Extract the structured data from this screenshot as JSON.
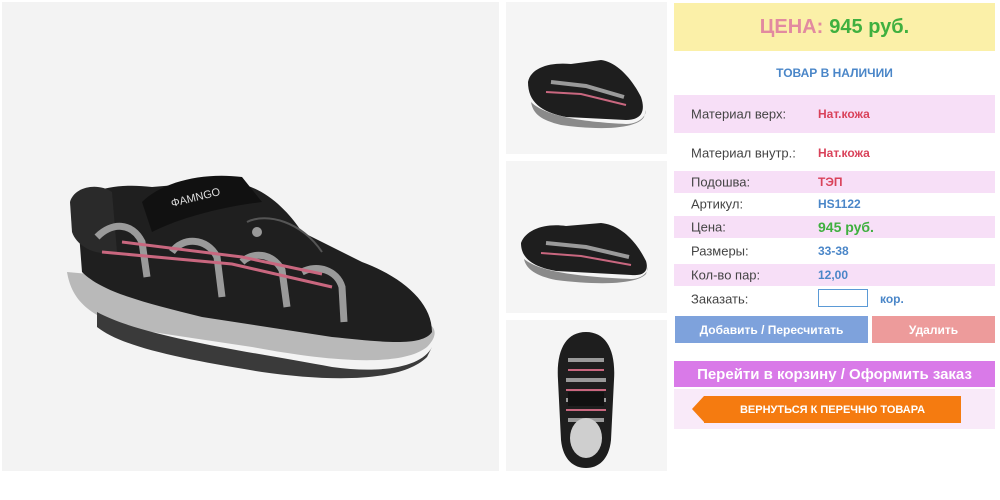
{
  "price_box": {
    "label": "ЦЕНА:",
    "value": "945 руб."
  },
  "stock": "ТОВАР В НАЛИЧИИ",
  "specs": [
    {
      "label": "Материал верх:",
      "value": "Нат.кожа"
    },
    {
      "label": "Материал внутр.:",
      "value": "Нат.кожа"
    },
    {
      "label": "Подошва:",
      "value": "ТЭП"
    },
    {
      "label": "Артикул:",
      "value": "HS1122"
    },
    {
      "label": "Цена:",
      "value": "945 руб."
    },
    {
      "label": "Размеры:",
      "value": "33-38"
    },
    {
      "label": "Кол-во пар:",
      "value": "12,00"
    }
  ],
  "order": {
    "label": "Заказать:",
    "input_value": "",
    "unit": "кор."
  },
  "buttons": {
    "add": "Добавить / Пересчитать",
    "delete": "Удалить",
    "cart": "Перейти в корзину / Оформить заказ",
    "back": "ВЕРНУТЬСЯ К ПЕРЕЧНЮ ТОВАРА"
  },
  "colors": {
    "price_bg": "#fbf0a8",
    "accent_green": "#3fb03f",
    "accent_blue": "#4a86c8",
    "accent_red": "#d9425a",
    "row_pink": "#f7dff7",
    "cart_btn": "#d97ae8",
    "back_btn": "#f57b10",
    "add_btn": "#7ea2dc",
    "del_btn": "#ed9b9b"
  },
  "images": {
    "main": "sandal-side-view",
    "thumbs": [
      "sandal-side-view",
      "sandal-side-view-alt",
      "sandal-top-view"
    ]
  }
}
